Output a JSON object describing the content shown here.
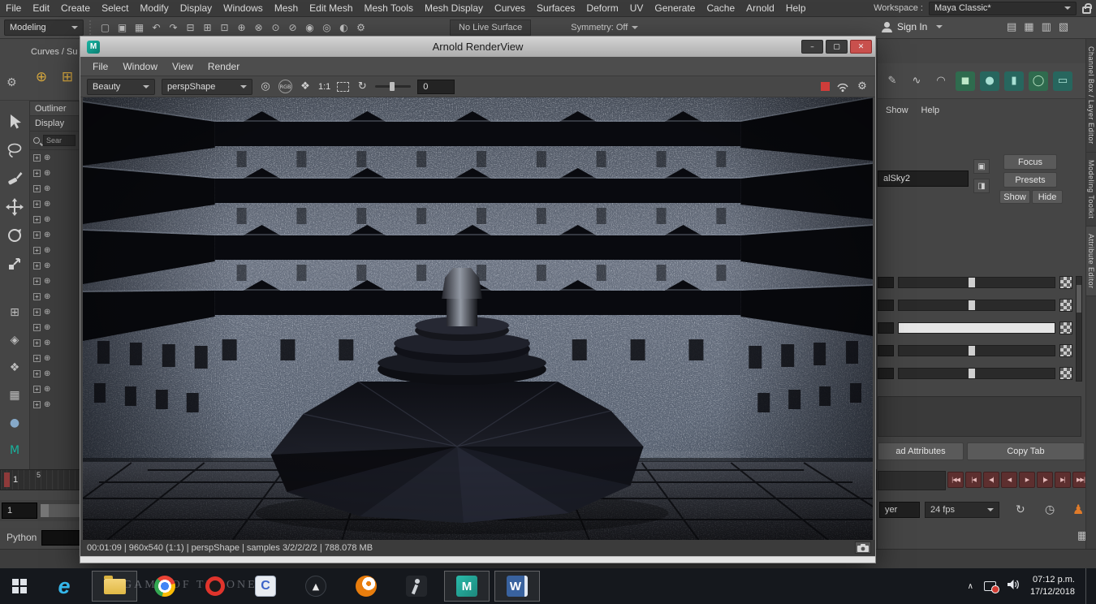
{
  "arnold": {
    "title": "Arnold RenderView",
    "menus": [
      "File",
      "Window",
      "View",
      "Render"
    ],
    "toolbar": {
      "aov": "Beauty",
      "camera": "perspShape",
      "ratio": "1:1",
      "exposure": "0"
    },
    "status": "00:01:09 | 960x540 (1:1) | perspShape  | samples 3/2/2/2/2 | 788.078 MB"
  },
  "maya": {
    "menus": [
      "File",
      "Edit",
      "Create",
      "Select",
      "Modify",
      "Display",
      "Windows",
      "Mesh",
      "Edit Mesh",
      "Mesh Tools",
      "Mesh Display",
      "Curves",
      "Surfaces",
      "Deform",
      "UV",
      "Generate",
      "Cache",
      "Arnold",
      "Help"
    ],
    "workspace": {
      "label": "Workspace :",
      "value": "Maya Classic*"
    },
    "statusline": {
      "menu_set": "Modeling",
      "no_live_surface": "No Live Surface",
      "symmetry": "Symmetry: Off",
      "sign_in": "Sign In"
    },
    "statusline_icons": [
      {
        "name": "new-scene-icon",
        "glyph": "▢"
      },
      {
        "name": "open-scene-icon",
        "glyph": "▣"
      },
      {
        "name": "save-scene-icon",
        "glyph": "▦"
      },
      {
        "name": "undo-icon",
        "glyph": "↶"
      },
      {
        "name": "redo-icon",
        "glyph": "↷"
      },
      {
        "name": "select-hierarchy-icon",
        "glyph": "⊟"
      },
      {
        "name": "select-object-icon",
        "glyph": "⊞"
      },
      {
        "name": "select-component-icon",
        "glyph": "⊡"
      },
      {
        "name": "snap-grid-icon",
        "glyph": "⊕"
      },
      {
        "name": "snap-curve-icon",
        "glyph": "⊗"
      },
      {
        "name": "snap-point-icon",
        "glyph": "⊙"
      },
      {
        "name": "snap-view-icon",
        "glyph": "⊘"
      },
      {
        "name": "make-live-icon",
        "glyph": "◉"
      },
      {
        "name": "render-current-frame-icon",
        "glyph": "◎"
      },
      {
        "name": "ipr-render-icon",
        "glyph": "◐"
      },
      {
        "name": "render-settings-icon",
        "glyph": "⚙"
      }
    ],
    "panel_toggles": [
      {
        "name": "toggle-single-pane-icon",
        "glyph": "▤"
      },
      {
        "name": "toggle-four-pane-icon",
        "glyph": "▦"
      },
      {
        "name": "toggle-outliner-pane-icon",
        "glyph": "▥"
      },
      {
        "name": "toggle-hypershade-pane-icon",
        "glyph": "▧"
      }
    ],
    "shelf": {
      "tab": "Curves / Su",
      "left_icons": [
        {
          "name": "nurbs-circle-icon",
          "glyph": "⊕",
          "color": "#d4a63e"
        },
        {
          "name": "nurbs-square-icon",
          "glyph": "⊞",
          "color": "#d4a63e"
        }
      ],
      "right_icons": [
        {
          "name": "pencil-curve-icon",
          "glyph": "✎",
          "color": "#c8c8c8"
        },
        {
          "name": "ep-curve-icon",
          "glyph": "∿",
          "color": "#c8c8c8"
        },
        {
          "name": "arc-curve-icon",
          "glyph": "◠",
          "color": "#c8c8c8"
        },
        {
          "name": "poly-cube-icon",
          "glyph": "◼",
          "color": "#bfe8c8",
          "bg": "#2f6b4e"
        },
        {
          "name": "poly-sphere-icon",
          "glyph": "●",
          "color": "#a8e0d4",
          "bg": "#27665e"
        },
        {
          "name": "poly-cylinder-icon",
          "glyph": "▮",
          "color": "#a8e0d4",
          "bg": "#27665e"
        },
        {
          "name": "poly-torus-icon",
          "glyph": "◯",
          "color": "#bfe8c8",
          "bg": "#2f6b4e"
        },
        {
          "name": "poly-plane-icon",
          "glyph": "▭",
          "color": "#a8e0d4",
          "bg": "#27665e"
        }
      ]
    },
    "outliner": {
      "title": "Outliner",
      "menu": "Display",
      "search": "Sear"
    },
    "tool_extra_icons": [
      {
        "name": "snap-together-icon",
        "glyph": "⊞"
      },
      {
        "name": "soft-select-icon",
        "glyph": "◈"
      },
      {
        "name": "cluster-icon",
        "glyph": "❖"
      },
      {
        "name": "lattice-icon",
        "glyph": "▦"
      },
      {
        "name": "viewport-ball-icon",
        "glyph": "●",
        "color": "#86a9c9"
      },
      {
        "name": "modeling-toolkit-icon",
        "glyph": "M",
        "color": "#18b29d"
      }
    ],
    "right_panel": {
      "menus": [
        "Show",
        "Help"
      ],
      "field_value": "alSky2",
      "focus": "Focus",
      "presets": "Presets",
      "show": "Show",
      "hide": "Hide",
      "load_attributes": "ad Attributes",
      "copy_tab": "Copy Tab",
      "layer_tab": "yer",
      "fps": "24 fps"
    },
    "vertical_tabs": [
      "Channel Box / Layer Editor",
      "Modeling Toolkit",
      "Attribute Editor"
    ],
    "transport": [
      {
        "name": "go-to-start-button",
        "glyph": "|◀◀"
      },
      {
        "name": "step-back-key-button",
        "glyph": "|◀"
      },
      {
        "name": "step-back-frame-button",
        "glyph": "◀|"
      },
      {
        "name": "play-backward-button",
        "glyph": "◀"
      },
      {
        "name": "play-forward-button",
        "glyph": "▶"
      },
      {
        "name": "step-forward-frame-button",
        "glyph": "|▶"
      },
      {
        "name": "step-forward-key-button",
        "glyph": "▶|"
      },
      {
        "name": "go-to-end-button",
        "glyph": "▶▶|"
      }
    ],
    "timeline": {
      "current": "1",
      "tick": "5",
      "range_start": "1"
    },
    "command_line_label": "Python"
  },
  "taskbar": {
    "wallpaper_text": "GAME OF THRONES",
    "clock": {
      "time": "07:12 p.m.",
      "date": "17/12/2018"
    }
  },
  "icons": {
    "plus": "+",
    "node": "⊕",
    "target": "◎",
    "rgb": "RGB",
    "swatch": "❖",
    "refresh": "↻",
    "gear": "⚙",
    "loop": "↻",
    "clock": "◷",
    "character": "♟",
    "grid": "▦",
    "tray_expand": "∧",
    "ie": "e",
    "c_app": "C",
    "unity": "▲",
    "maya": "M",
    "word": "W",
    "min": "–",
    "max": "▢",
    "close": "✕"
  },
  "colors": {
    "close_button": "#c9504d",
    "maya_teal": "#12a796",
    "taskbar_bg": "#15181d",
    "render_stop": "#cf3d3a",
    "playback_red": "#5d2f2f"
  }
}
